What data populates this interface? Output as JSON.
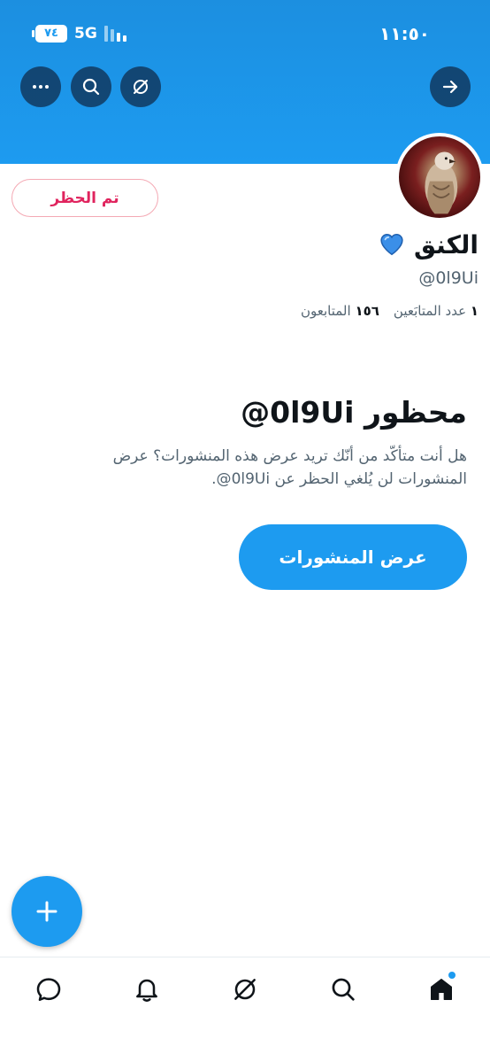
{
  "status_bar": {
    "time": "١١:٥٠",
    "network": "5G",
    "battery": "٧٤"
  },
  "header": {
    "back_icon": "arrow-right-icon",
    "actions": [
      "grok-icon",
      "search-icon",
      "more-icon"
    ]
  },
  "profile": {
    "display_name": "الكنق",
    "badge_icon": "blue-heart-icon",
    "handle": "@0l9Ui",
    "following_count": "١",
    "following_label": "عدد المتابَعين",
    "followers_count": "١٥٦",
    "followers_label": "المتابعون",
    "blocked_button_label": "تم الحظر"
  },
  "blocked_notice": {
    "title": "محظور 0l9Ui@",
    "description": "هل أنت متأكّد من أنّك تريد عرض هذه المنشورات؟ عرض المنشورات لن يُلغي الحظر عن 0l9Ui@.",
    "view_posts_label": "عرض المنشورات"
  },
  "bottom_nav": {
    "items": [
      "messages-icon",
      "notifications-icon",
      "grok-icon",
      "search-icon",
      "home-icon"
    ],
    "active": "home-icon"
  },
  "colors": {
    "accent": "#1d9bf0",
    "blocked_red": "#e0245e"
  }
}
